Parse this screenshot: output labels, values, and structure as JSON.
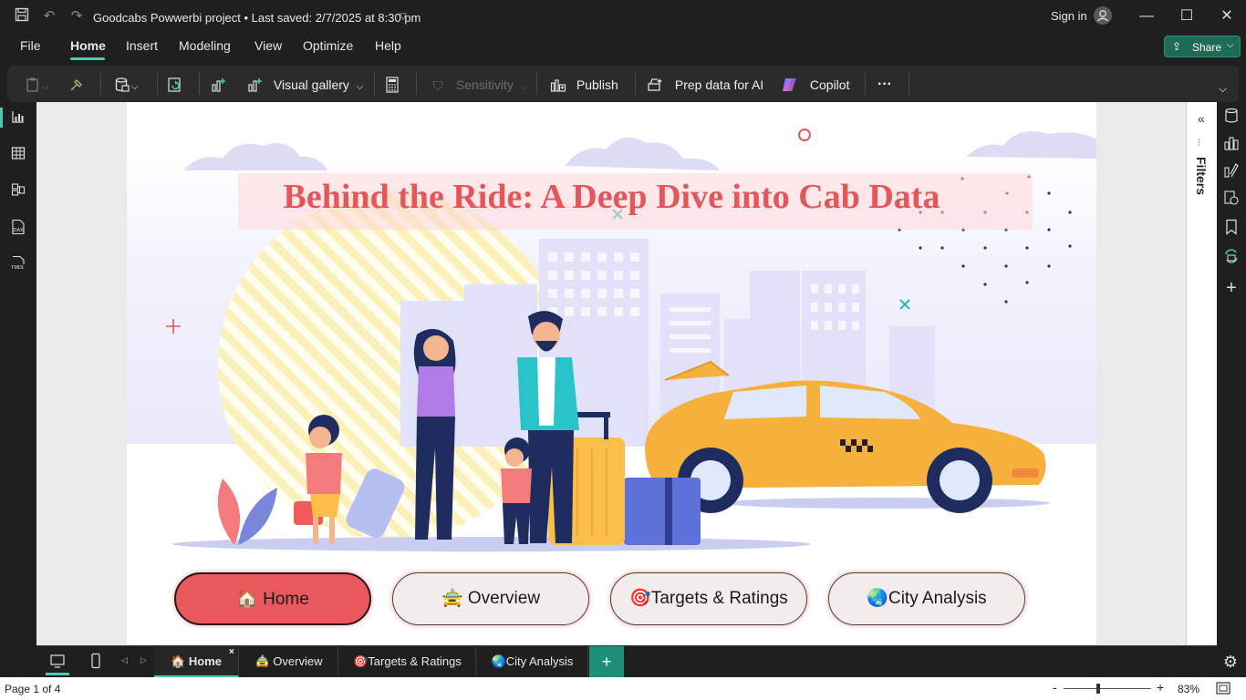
{
  "titlebar": {
    "doc_title": "Goodcabs Powwerbi project • Last saved: 2/7/2025 at 8:30 pm",
    "sign_in": "Sign in"
  },
  "menu": {
    "items": [
      "File",
      "Home",
      "Insert",
      "Modeling",
      "View",
      "Optimize",
      "Help"
    ],
    "active": "Home",
    "share_label": "Share"
  },
  "ribbon": {
    "visual_gallery": "Visual gallery",
    "sensitivity": "Sensitivity",
    "publish": "Publish",
    "prep_data": "Prep data for AI",
    "copilot": "Copilot",
    "more": "···"
  },
  "left_rail": {
    "dax_label": "DAX",
    "tmdl_label": "TMDL"
  },
  "filters_pane": {
    "label": "Filters"
  },
  "report": {
    "title": "Behind the Ride: A Deep Dive into Cab Data",
    "nav_buttons": [
      {
        "label": "🏠 Home",
        "active": true
      },
      {
        "label": "🚖 Overview",
        "active": false
      },
      {
        "label": "🎯Targets & Ratings",
        "active": false
      },
      {
        "label": "🌏City Analysis",
        "active": false
      }
    ]
  },
  "tabs": [
    {
      "label": "🏠 Home",
      "active": true
    },
    {
      "label": "🚖 Overview",
      "active": false
    },
    {
      "label": "🎯Targets & Ratings",
      "active": false
    },
    {
      "label": "🌏City Analysis",
      "active": false
    }
  ],
  "status": {
    "page": "Page 1 of 4",
    "zoom": "83%"
  },
  "colors": {
    "accent": "#4ec9b0",
    "title_red": "#e4565a",
    "button_active": "#e8585c",
    "taxi_yellow": "#f6b13d",
    "share_green": "#1e6b54"
  }
}
